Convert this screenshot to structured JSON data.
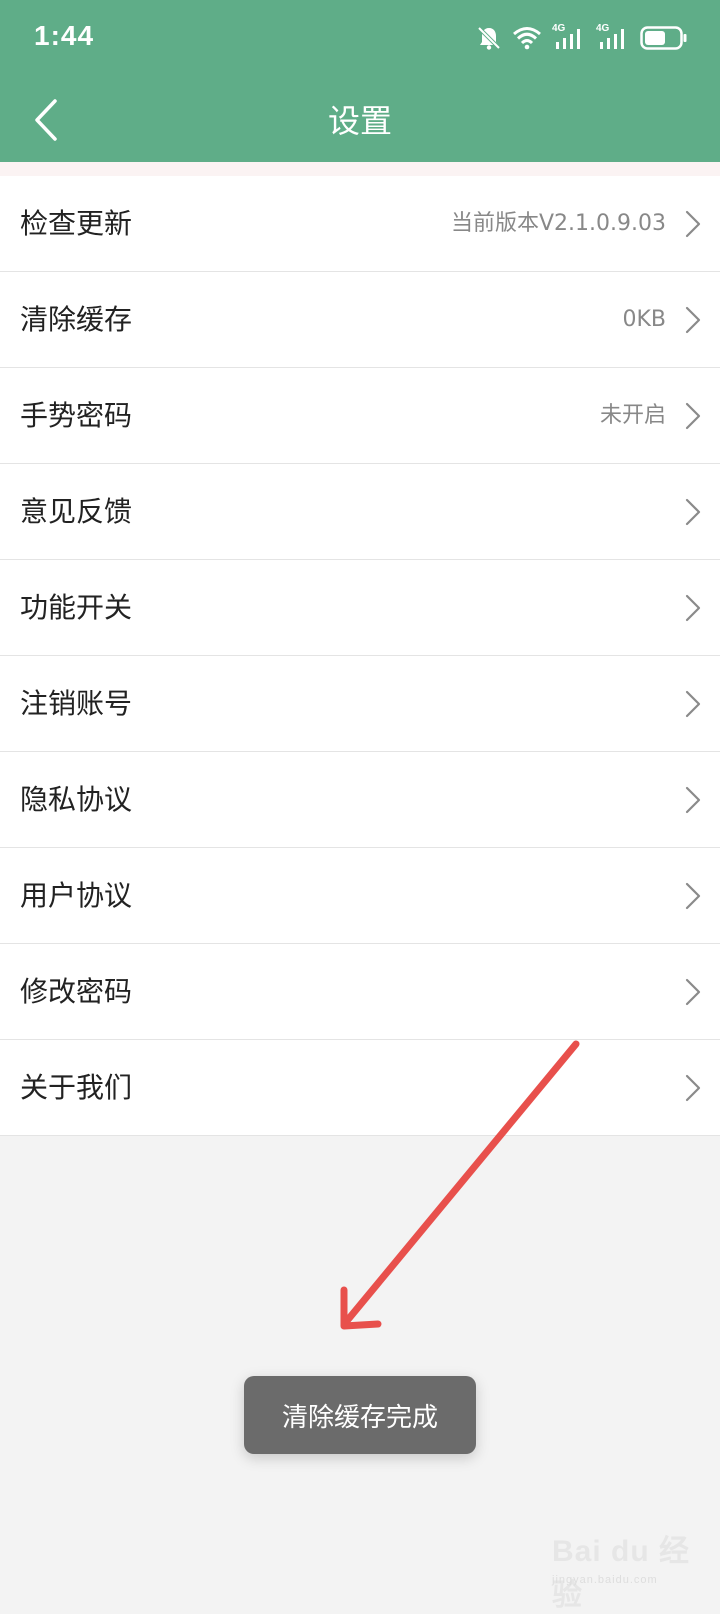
{
  "status_bar": {
    "time": "1:44",
    "icons": [
      "bell-off-icon",
      "wifi-icon",
      "signal-4g-icon",
      "signal-4g-icon",
      "battery-icon"
    ],
    "network_label_1": "4G",
    "network_label_2": "4G"
  },
  "header": {
    "title": "设置",
    "back_icon": "chevron-left-icon",
    "background_color": "#5fad88"
  },
  "settings": {
    "items": [
      {
        "label": "检查更新",
        "value": "当前版本V2.1.0.9.03"
      },
      {
        "label": "清除缓存",
        "value": "0KB"
      },
      {
        "label": "手势密码",
        "value": "未开启"
      },
      {
        "label": "意见反馈",
        "value": ""
      },
      {
        "label": "功能开关",
        "value": ""
      },
      {
        "label": "注销账号",
        "value": ""
      },
      {
        "label": "隐私协议",
        "value": ""
      },
      {
        "label": "用户协议",
        "value": ""
      },
      {
        "label": "修改密码",
        "value": ""
      },
      {
        "label": "关于我们",
        "value": ""
      }
    ]
  },
  "toast": {
    "message": "清除缓存完成"
  },
  "annotation": {
    "arrow_color": "#e8504c"
  },
  "watermark": {
    "text": "Bai du 经验",
    "subtext": "jingyan.baidu.com"
  }
}
